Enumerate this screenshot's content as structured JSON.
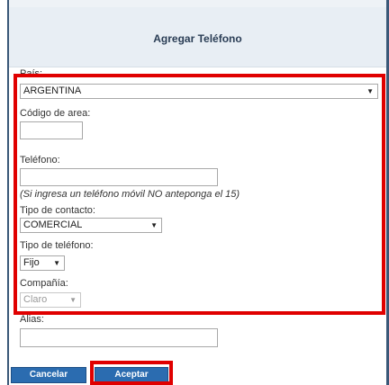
{
  "dialog": {
    "title": "Agregar Teléfono"
  },
  "form": {
    "pais_label": "País:",
    "pais_value": "ARGENTINA",
    "codigo_label": "Código de area:",
    "codigo_value": "",
    "telefono_label": "Teléfono:",
    "telefono_value": "",
    "telefono_hint": "(Si ingresa un teléfono móvil NO anteponga el 15)",
    "tipo_contacto_label": "Tipo de contacto:",
    "tipo_contacto_value": "COMERCIAL",
    "tipo_telefono_label": "Tipo de teléfono:",
    "tipo_telefono_value": "Fijo",
    "compania_label": "Compañía:",
    "compania_value": "Claro",
    "alias_label": "Alias:",
    "alias_value": ""
  },
  "buttons": {
    "cancel": "Cancelar",
    "accept": "Aceptar"
  },
  "icons": {
    "dropdown": "chevron-down-icon"
  },
  "colors": {
    "highlight": "#e00000",
    "button": "#2b6cb0",
    "header": "#e8eef4"
  }
}
